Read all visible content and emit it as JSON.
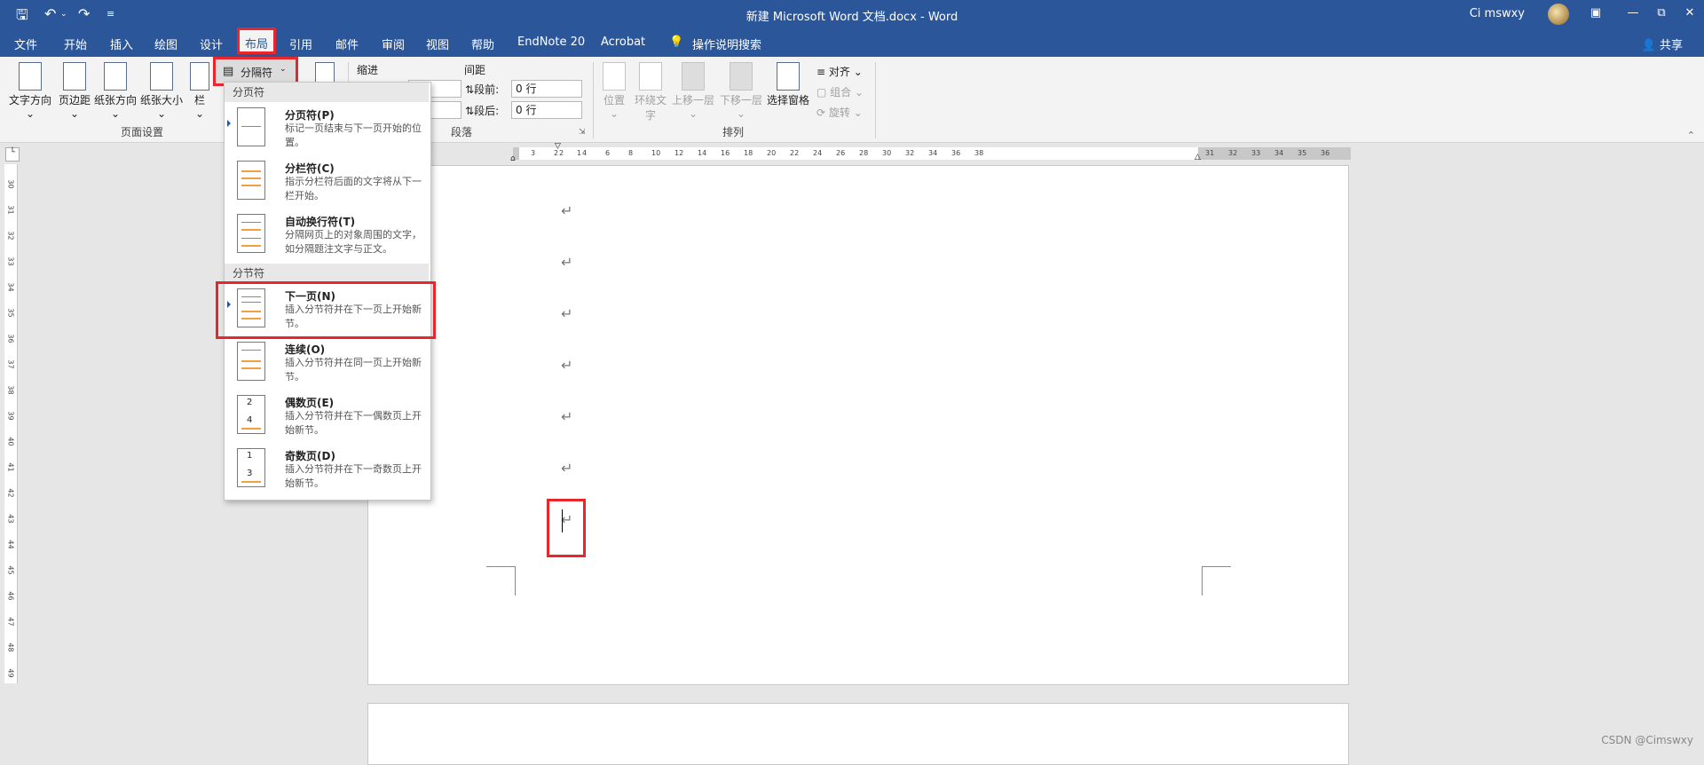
{
  "title_bar": {
    "doc_title": "新建 Microsoft Word 文档.docx  -  Word",
    "user_name": "Ci mswxy",
    "quick_access": [
      "save-icon",
      "undo-icon",
      "redo-icon",
      "customize-icon"
    ],
    "window_buttons": [
      "ribbon-display-icon",
      "minimize-icon",
      "restore-icon",
      "close-icon"
    ]
  },
  "menu": {
    "tabs": [
      "文件",
      "开始",
      "插入",
      "绘图",
      "设计",
      "布局",
      "引用",
      "邮件",
      "审阅",
      "视图",
      "帮助",
      "EndNote 20",
      "Acrobat"
    ],
    "tell_me": "操作说明搜索",
    "share": "共享"
  },
  "ribbon": {
    "page_setup": {
      "group_label": "页面设置",
      "buttons": [
        "文字方向",
        "页边距",
        "纸张方向",
        "纸张大小",
        "栏"
      ],
      "breaks_label": "分隔符"
    },
    "paragraph": {
      "group_label": "段落",
      "indent_label": "缩进",
      "spacing_label": "间距",
      "before_label": "段前:",
      "after_label": "段后:",
      "before_value": "0 行",
      "after_value": "0 行"
    },
    "arrange": {
      "group_label": "排列",
      "buttons": [
        "位置",
        "环绕文字",
        "上移一层",
        "下移一层",
        "选择窗格"
      ],
      "small_buttons": [
        "对齐",
        "组合",
        "旋转"
      ]
    }
  },
  "breaks_menu": {
    "page_breaks_header": "分页符",
    "section_breaks_header": "分节符",
    "items": [
      {
        "title": "分页符(P)",
        "desc": "标记一页结束与下一页开始的位置。"
      },
      {
        "title": "分栏符(C)",
        "desc": "指示分栏符后面的文字将从下一栏开始。"
      },
      {
        "title": "自动换行符(T)",
        "desc": "分隔网页上的对象周围的文字，如分隔题注文字与正文。"
      },
      {
        "title": "下一页(N)",
        "desc": "插入分节符并在下一页上开始新节。"
      },
      {
        "title": "连续(O)",
        "desc": "插入分节符并在同一页上开始新节。"
      },
      {
        "title": "偶数页(E)",
        "desc": "插入分节符并在下一偶数页上开始新节。"
      },
      {
        "title": "奇数页(D)",
        "desc": "插入分节符并在下一奇数页上开始新节。"
      }
    ]
  },
  "rulers": {
    "horizontal_left": [
      "3",
      "2",
      "1"
    ],
    "horizontal": [
      "2",
      "4",
      "6",
      "8",
      "10",
      "12",
      "14",
      "16",
      "18",
      "20",
      "22",
      "24",
      "26",
      "28",
      "30",
      "32",
      "34",
      "36",
      "38"
    ],
    "horizontal_right": [
      "31",
      "32",
      "33",
      "34",
      "35",
      "36"
    ],
    "vertical": [
      "30",
      "31",
      "32",
      "33",
      "34",
      "35",
      "36",
      "37",
      "38",
      "39",
      "40",
      "41",
      "42",
      "43",
      "44",
      "45",
      "46",
      "47",
      "48",
      "49"
    ]
  },
  "document": {
    "paragraph_mark": "↵",
    "paragraph_count": 7
  },
  "watermark": "CSDN @Cimswxy"
}
